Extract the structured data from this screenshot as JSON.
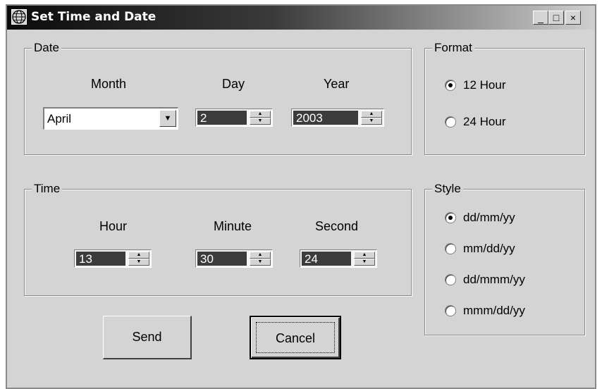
{
  "window": {
    "title": "Set Time and Date",
    "icon": "globe-icon",
    "controls": {
      "minimize": "_",
      "maximize": "□",
      "close": "×"
    }
  },
  "date_group": {
    "legend": "Date",
    "month_label": "Month",
    "day_label": "Day",
    "year_label": "Year",
    "month_value": "April",
    "day_value": "2",
    "year_value": "2003"
  },
  "time_group": {
    "legend": "Time",
    "hour_label": "Hour",
    "minute_label": "Minute",
    "second_label": "Second",
    "hour_value": "13",
    "minute_value": "30",
    "second_value": "24"
  },
  "format_group": {
    "legend": "Format",
    "options": [
      {
        "label": "12 Hour",
        "selected": true
      },
      {
        "label": "24 Hour",
        "selected": false
      }
    ]
  },
  "style_group": {
    "legend": "Style",
    "options": [
      {
        "label": "dd/mm/yy",
        "selected": true
      },
      {
        "label": "mm/dd/yy",
        "selected": false
      },
      {
        "label": "dd/mmm/yy",
        "selected": false
      },
      {
        "label": "mmm/dd/yy",
        "selected": false
      }
    ]
  },
  "buttons": {
    "send": "Send",
    "cancel": "Cancel"
  }
}
